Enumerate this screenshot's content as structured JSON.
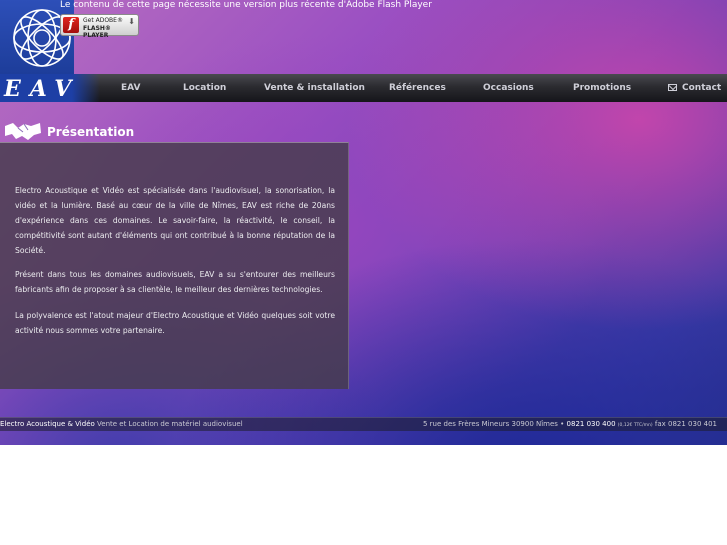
{
  "flash": {
    "message": "Le contenu de cette page nécessite une version plus récente d'Adobe Flash Player",
    "badge_line1": "Get ADOBE®",
    "badge_line2": "FLASH® PLAYER"
  },
  "logo": {
    "text": "EAV"
  },
  "nav": {
    "items": [
      {
        "label": "EAV"
      },
      {
        "label": "Location"
      },
      {
        "label": "Vente & installation"
      },
      {
        "label": "Références"
      },
      {
        "label": "Occasions"
      },
      {
        "label": "Promotions"
      },
      {
        "label": "Contact"
      }
    ]
  },
  "section": {
    "title": "Présentation"
  },
  "content": {
    "paragraphs": [
      "Electro Acoustique et Vidéo est spécialisée dans l'audiovisuel, la sonorisation, la vidéo et la lumière. Basé au cœur de la ville de Nîmes, EAV est riche de 20ans d'expérience dans ces domaines. Le savoir-faire, la réactivité, le conseil, la compétitivité sont autant d'éléments qui ont contribué à la bonne réputation de la Société.",
      "Présent dans tous les domaines audiovisuels, EAV a su s'entourer des meilleurs fabricants afin de proposer à sa clientèle, le meilleur des dernières technologies.",
      "La polyvalence est l'atout majeur d'Electro Acoustique et Vidéo quelques soit votre activité nous sommes votre partenaire."
    ]
  },
  "footer": {
    "company": "Electro Acoustique & Vidéo",
    "tagline": "Vente et Location de matériel audiovisuel",
    "address": "5 rue des Frères Mineurs 30900 Nîmes •",
    "phone": "0821 030 400",
    "phone_note": "(0,12€ TTC/mn)",
    "fax": "fax 0821 030 401"
  }
}
